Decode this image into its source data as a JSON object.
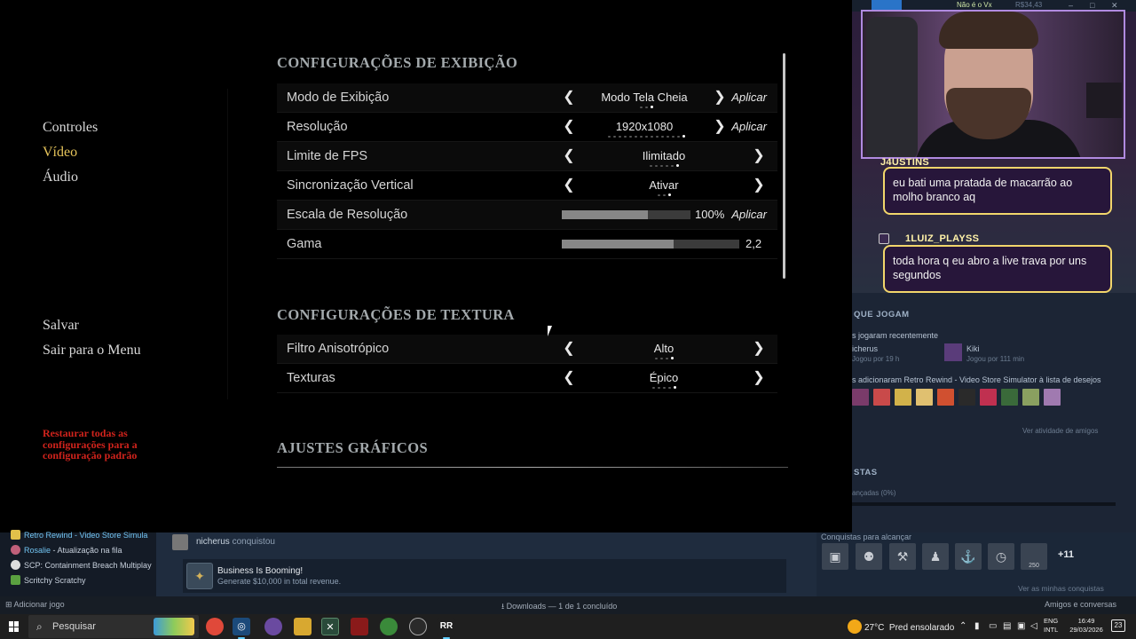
{
  "game": {
    "side_menu": [
      {
        "label": "Controles"
      },
      {
        "label": "Vídeo"
      },
      {
        "label": "Áudio"
      }
    ],
    "side_actions": [
      {
        "label": "Salvar"
      },
      {
        "label": "Sair para o Menu"
      }
    ],
    "restore_label": "Restaurar todas as configurações para a configuração padrão",
    "display_section": {
      "title": "CONFIGURAÇÕES DE EXIBIÇÃO",
      "rows": [
        {
          "label": "Modo de Exibição",
          "value": "Modo Tela Cheia",
          "apply": "Aplicar"
        },
        {
          "label": "Resolução",
          "value": "1920x1080",
          "apply": "Aplicar"
        },
        {
          "label": "Limite de FPS",
          "value": "Ilimitado"
        },
        {
          "label": "Sincronização Vertical",
          "value": "Ativar"
        },
        {
          "label": "Escala de Resolução",
          "value": "100%",
          "level": 0.67,
          "apply": "Aplicar"
        },
        {
          "label": "Gama",
          "value": "2,2",
          "level": 0.63
        }
      ]
    },
    "texture_section": {
      "title": "CONFIGURAÇÕES DE TEXTURA",
      "rows": [
        {
          "label": "Filtro Anisotrópico",
          "value": "Alto"
        },
        {
          "label": "Texturas",
          "value": "Épico"
        }
      ]
    },
    "graphics_section": {
      "title": "AJUSTES GRÁFICOS"
    }
  },
  "stream": {
    "top_nick": "Não é o Vx",
    "top_money": "R$34,43",
    "chat": [
      {
        "user": "J4USTINS",
        "message": "eu bati uma pratada de macarrão ao molho branco aq"
      },
      {
        "user": "1LUIZ_PLAYSS",
        "message": "toda hora q eu abro a live trava por uns segundos"
      }
    ]
  },
  "steam": {
    "friends_heading": "QUE JOGAM",
    "recent_label": "s jogaram recentemente",
    "friends": [
      {
        "name": "icherus",
        "status": "Jogou por 19 h"
      },
      {
        "name": "Kiki",
        "status": "Jogou por 111 min"
      }
    ],
    "wishlist_text": "s adicionaram Retro Rewind - Video Store Simulator à lista de desejos",
    "friends_activity_link": "Ver atividade de amigos",
    "achievements_heading": "STAS",
    "achievements_progress_text": "ançadas (0%)",
    "achievements_progress": 0,
    "to_reach_label": "Conquistas para alcançar",
    "badge_250": "250",
    "more_count": "+11",
    "see_all_link": "Ver as minhas conquistas",
    "library": [
      {
        "name": "Retro Rewind - Video Store Simula",
        "color": "#e2c04a"
      },
      {
        "name": "Rosalie",
        "suffix": " - Atualização na fila",
        "color": "#c0607a"
      },
      {
        "name": "SCP: Containment Breach Multiplay",
        "color": "#dddddd"
      },
      {
        "name": "Scritchy Scratchy",
        "color": "#5aa040"
      }
    ],
    "activity_user": "nicherus",
    "activity_verb": "conquistou",
    "achievement_title": "Business Is Booming!",
    "achievement_desc": "Generate $10,000 in total revenue.",
    "add_game": "Adicionar jogo",
    "downloads": "Downloads — 1 de 1 concluído",
    "friends_chat": "Amigos e conversas"
  },
  "taskbar": {
    "search_placeholder": "Pesquisar",
    "weather": "27°C",
    "weather_desc": "Pred ensolarado",
    "lang_1": "ENG",
    "lang_2": "INTL",
    "time": "16:49",
    "date": "29/03/2026",
    "notifications": "23"
  }
}
